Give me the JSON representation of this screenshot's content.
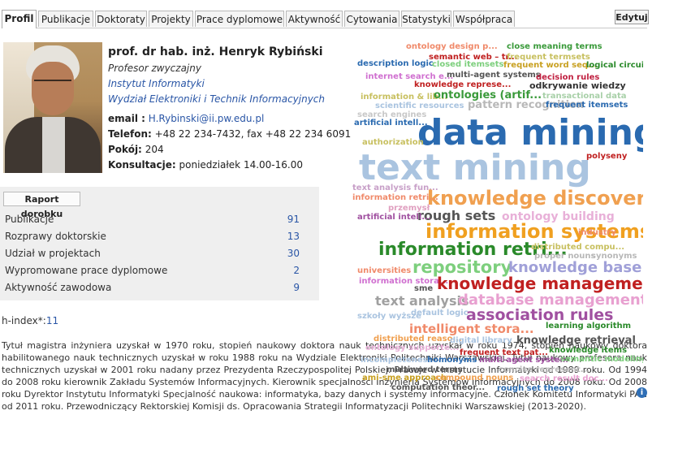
{
  "tabs": [
    "Profil",
    "Publikacje",
    "Doktoraty",
    "Projekty",
    "Prace dyplomowe",
    "Aktywność",
    "Cytowania",
    "Statystyki",
    "Współpraca"
  ],
  "edit_label": "Edytuj",
  "profile": {
    "name": "prof. dr hab. inż. Henryk Rybiński",
    "position": "Profesor zwyczajny",
    "institute": "Instytut Informatyki",
    "faculty": "Wydział Elektroniki i Technik Informacyjnych",
    "email_label": "email :",
    "email": "H.Rybinski@ii.pw.edu.pl",
    "phone_label": "Telefon:",
    "phone": "+48 22 234-7432, fax +48 22 234 6091",
    "room_label": "Pokój:",
    "room": "204",
    "hours_label": "Konsultacje:",
    "hours": "poniedziałek 14.00-16.00"
  },
  "report_button": "Raport dorobku",
  "stats": [
    {
      "label": "Publikacje",
      "value": "91"
    },
    {
      "label": "Rozprawy doktorskie",
      "value": "13"
    },
    {
      "label": "Udział w projektach",
      "value": "30"
    },
    {
      "label": "Wypromowane prace dyplomowe",
      "value": "2"
    },
    {
      "label": "Aktywność zawodowa",
      "value": "9"
    }
  ],
  "hindex_label": "h-index*:",
  "hindex_value": "11",
  "bio": "Tytuł magistra inżyniera uzyskał w 1970 roku, stopień naukowy doktora nauk technicznych uzyskał w roku 1974, stopień naukowy doktora habilitowanego nauk technicznych uzyskał w roku 1988 roku na Wydziale Elektroniki Politechniki Warszawskiej. Tytuł naukowy profesora nauk technicznych uzyskał w 2001 roku nadany przez Prezydenta Rzeczypospolitej Polskiej. Pracuje w Instytucie Informatyki od 1989 roku. Od 1994 do 2008 roku kierownik Zakładu Systemów Informacyjnych. Kierownik specjalności Inżynieria Systemów Informacyjnych do 2008 roku. Od 2008 roku Dyrektor Instytutu Informatyki Specjalność naukowa: informatyka, bazy danych i systemy informacyjne. Członek Komitetu Informatyki PAN od 2011 roku. Przewodniczący Rektorskiej Komisji ds. Opracowania Strategii Informatyzacji Politechniki Warszawskiej (2013-2020).",
  "cloud_words": [
    {
      "t": "ontology design p...",
      "c": "#f08a6a"
    },
    {
      "t": "close meaning terms",
      "c": "#3a9a3a"
    },
    {
      "t": "semantic web – tr...",
      "c": "#c02020"
    },
    {
      "t": "frequent termsets",
      "c": "#c8c060"
    },
    {
      "t": "description logic",
      "c": "#2a6ab0"
    },
    {
      "t": "closed itemsets",
      "c": "#7dcf7d"
    },
    {
      "t": "frequent word seq...",
      "c": "#c8a020"
    },
    {
      "t": "logical circuit",
      "c": "#2a8a2a"
    },
    {
      "t": "internet search e...",
      "c": "#d070d0"
    },
    {
      "t": "multi-agent systems",
      "c": "#555555"
    },
    {
      "t": "decision rules",
      "c": "#c02040"
    },
    {
      "t": "knowledge represe...",
      "c": "#c02020"
    },
    {
      "t": "odkrywanie wiedzy",
      "c": "#333333"
    },
    {
      "t": "information & lib...",
      "c": "#c8c060"
    },
    {
      "t": "ontologies (artif...",
      "c": "#3a9a3a"
    },
    {
      "t": "transactional data",
      "c": "#a8d0a8"
    },
    {
      "t": "scientific resources",
      "c": "#aac4e0"
    },
    {
      "t": "pattern recognition",
      "c": "#b8b8b8"
    },
    {
      "t": "frequent itemsets",
      "c": "#2a6ab0"
    },
    {
      "t": "search engines",
      "c": "#c8c8c8"
    },
    {
      "t": "artificial intell...",
      "c": "#2a6ab0"
    },
    {
      "t": "data mining",
      "c": "#2a6ab0"
    },
    {
      "t": "authorization",
      "c": "#c8c060"
    },
    {
      "t": "polyseny",
      "c": "#c02020"
    },
    {
      "t": "text mining",
      "c": "#aac4e0"
    },
    {
      "t": "text analysis fun...",
      "c": "#c8a0c8"
    },
    {
      "t": "knowledge discovery",
      "c": "#f0a050"
    },
    {
      "t": "information retri...",
      "c": "#f08a6a"
    },
    {
      "t": "przemysł",
      "c": "#e0a0c0"
    },
    {
      "t": "rough sets",
      "c": "#555555"
    },
    {
      "t": "ontology building",
      "c": "#e8b0d8"
    },
    {
      "t": "artificial intell...",
      "c": "#a050a0"
    },
    {
      "t": "information systems",
      "c": "#f0a020"
    },
    {
      "t": "industry",
      "c": "#f08a6a"
    },
    {
      "t": "information retri...",
      "c": "#2a8a2a"
    },
    {
      "t": "distributed compu...",
      "c": "#c8c060"
    },
    {
      "t": "proper nouns",
      "c": "#b8b8b8"
    },
    {
      "t": "synonyms",
      "c": "#b8b8b8"
    },
    {
      "t": "repository",
      "c": "#7dcf7d"
    },
    {
      "t": "knowledge base",
      "c": "#a0a0d8"
    },
    {
      "t": "universities",
      "c": "#f08a6a"
    },
    {
      "t": "information stora...",
      "c": "#d070d0"
    },
    {
      "t": "knowledge management",
      "c": "#c02020"
    },
    {
      "t": "sme",
      "c": "#555555"
    },
    {
      "t": "text analysis",
      "c": "#a0a0a0"
    },
    {
      "t": "database management",
      "c": "#e8a0d0"
    },
    {
      "t": "szkoły wyższe",
      "c": "#aac4e0"
    },
    {
      "t": "default logic",
      "c": "#aac4e0"
    },
    {
      "t": "association rules",
      "c": "#a050a0"
    },
    {
      "t": "intelligent stora...",
      "c": "#f08a6a"
    },
    {
      "t": "learning algorithm",
      "c": "#2a8a2a"
    },
    {
      "t": "distributed reaso...",
      "c": "#f0a050"
    },
    {
      "t": "digital library",
      "c": "#aac4e0"
    },
    {
      "t": "knowledge retrieval",
      "c": "#555555"
    },
    {
      "t": "ontology supporte...",
      "c": "#e8b0d8"
    },
    {
      "t": "frequent text pat...",
      "c": "#c02020"
    },
    {
      "t": "knowledge items",
      "c": "#2a8a2a"
    },
    {
      "t": "incompleteness",
      "c": "#aac4e0"
    },
    {
      "t": "homonyms",
      "c": "#2a6ab0"
    },
    {
      "t": "multi-agent system",
      "c": "#a050a0"
    },
    {
      "t": "semantic modeling",
      "c": "#7dcf7d"
    },
    {
      "t": "multiword terms",
      "c": "#555555"
    },
    {
      "t": "concise represent...",
      "c": "#b8b8b8"
    },
    {
      "t": "ami-sme approach",
      "c": "#c8a020"
    },
    {
      "t": "compound nouns",
      "c": "#f0a050"
    },
    {
      "t": "search result doc...",
      "c": "#e8a0d0"
    },
    {
      "t": "computation theor...",
      "c": "#555555"
    },
    {
      "t": "rough set theory",
      "c": "#2a6ab0"
    }
  ]
}
